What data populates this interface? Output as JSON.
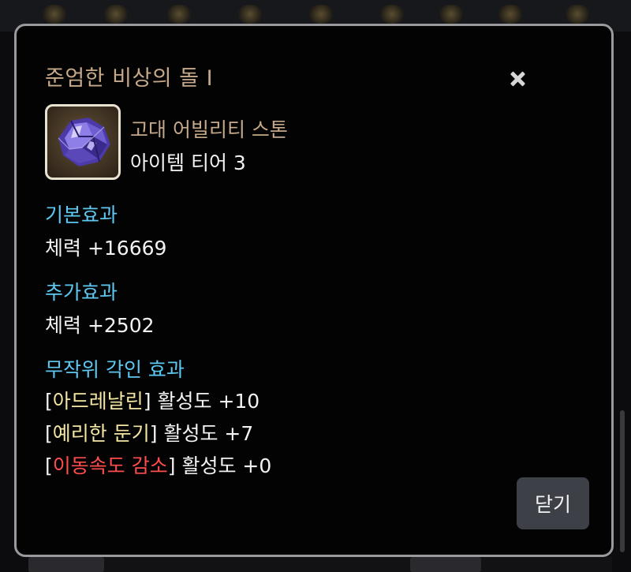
{
  "modal": {
    "title": "준엄한 비상의 돌 I",
    "close_button_label": "닫기"
  },
  "item": {
    "name": "고대 어빌리티 스톤",
    "tier": "아이템 티어 3"
  },
  "basic_effect": {
    "title": "기본효과",
    "line": "체력 +16669"
  },
  "additional_effect": {
    "title": "추가효과",
    "line": "체력 +2502"
  },
  "engravings": {
    "title": "무작위 각인 효과",
    "items": [
      {
        "name": "아드레날린",
        "value": "활성도 +10",
        "color": "#f3e6a2"
      },
      {
        "name": "예리한 둔기",
        "value": "활성도 +7",
        "color": "#f3e6a2"
      },
      {
        "name": "이동속도 감소",
        "value": "활성도 +0",
        "color": "#ff4d4d"
      }
    ]
  },
  "colors": {
    "title_tan": "#c6a98a",
    "section_blue": "#5ec8f2",
    "border_gray": "#9a9a9e"
  },
  "icons": {
    "close": "close-icon",
    "item": "ability-stone-icon"
  }
}
